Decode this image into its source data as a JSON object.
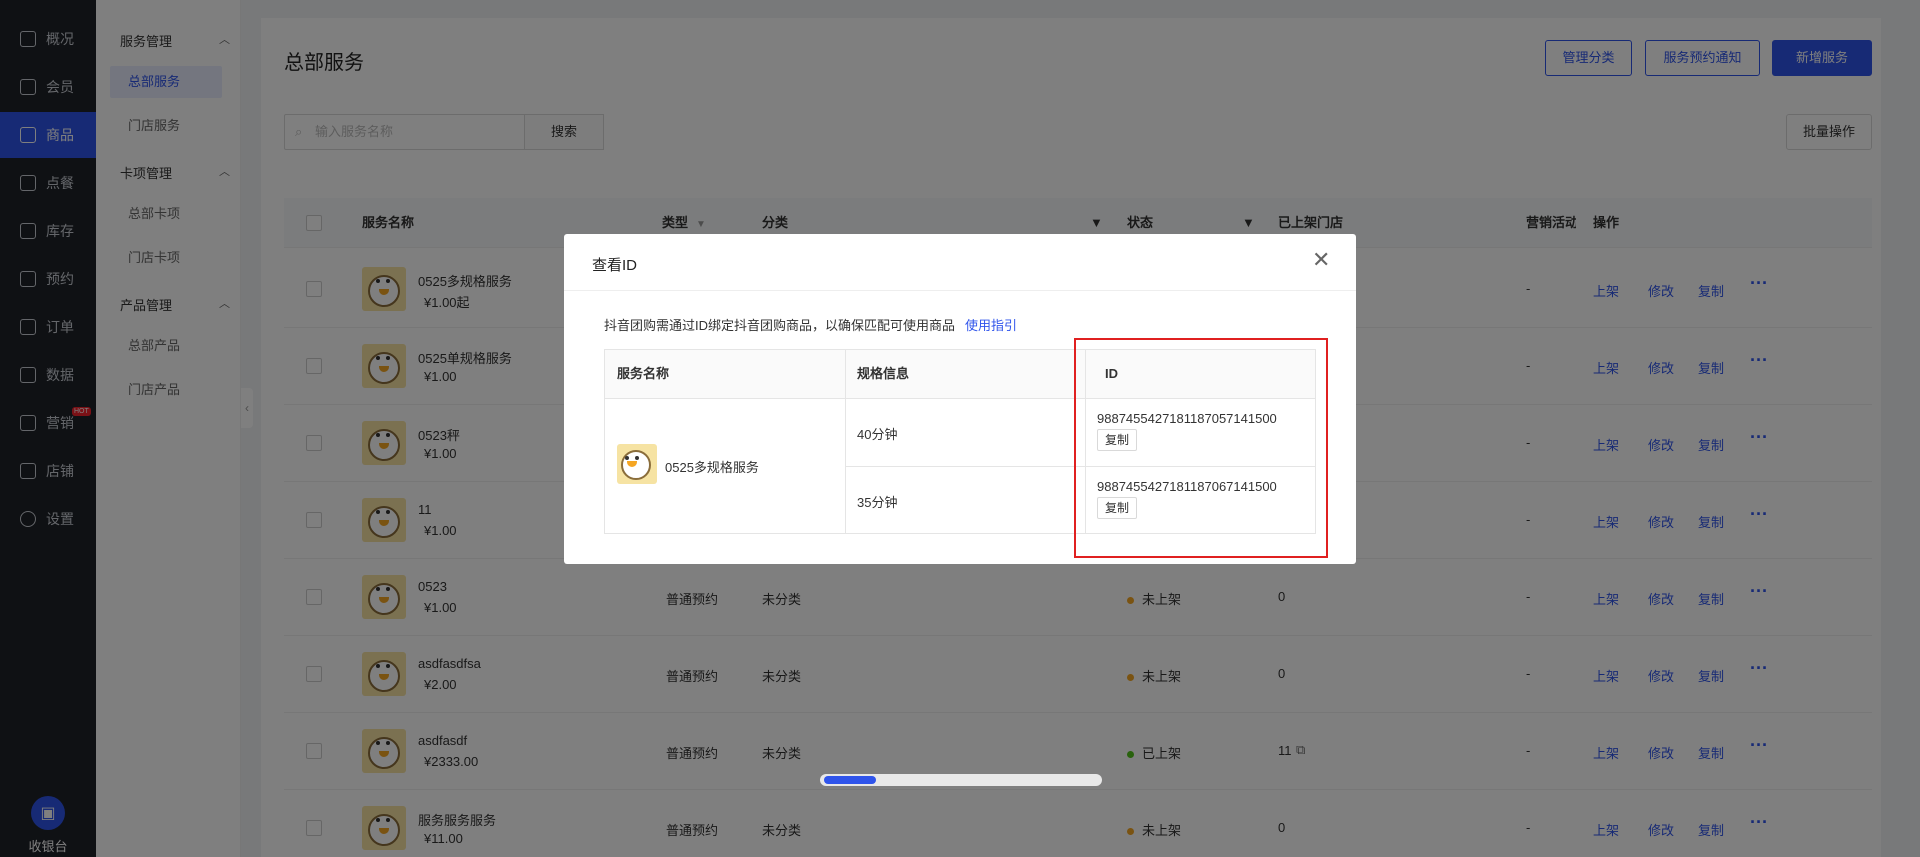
{
  "nav": {
    "items": [
      {
        "label": "概况",
        "icon": "grid-icon"
      },
      {
        "label": "会员",
        "icon": "crown-icon"
      },
      {
        "label": "商品",
        "icon": "store-icon"
      },
      {
        "label": "点餐",
        "icon": "dish-icon"
      },
      {
        "label": "库存",
        "icon": "warehouse-icon"
      },
      {
        "label": "预约",
        "icon": "calendar-check-icon"
      },
      {
        "label": "订单",
        "icon": "order-icon"
      },
      {
        "label": "数据",
        "icon": "chart-icon"
      },
      {
        "label": "营销",
        "icon": "gift-icon"
      },
      {
        "label": "店铺",
        "icon": "shop-icon"
      },
      {
        "label": "设置",
        "icon": "gear-icon"
      }
    ],
    "hot_badge": "HOT",
    "cashier_label": "收银台"
  },
  "subnav": {
    "groups": [
      {
        "title": "服务管理",
        "items": [
          "总部服务",
          "门店服务"
        ]
      },
      {
        "title": "卡项管理",
        "items": [
          "总部卡项",
          "门店卡项"
        ]
      },
      {
        "title": "产品管理",
        "items": [
          "总部产品",
          "门店产品"
        ]
      }
    ]
  },
  "header": {
    "title": "总部服务",
    "manage_category": "管理分类",
    "booking_notice": "服务预约通知",
    "add_service": "新增服务",
    "batch_ops": "批量操作"
  },
  "search": {
    "placeholder": "输入服务名称",
    "button": "搜索"
  },
  "table": {
    "columns": [
      "服务名称",
      "类型",
      "分类",
      "状态",
      "已上架门店",
      "营销活动",
      "操作"
    ],
    "ops": [
      "上架",
      "修改",
      "复制"
    ],
    "rows": [
      {
        "name": "0525多规格服务",
        "price": "¥1.00起",
        "type": "",
        "category": "",
        "status": "",
        "stores": "",
        "marketing": "-"
      },
      {
        "name": "0525单规格服务",
        "price": "¥1.00",
        "type": "",
        "category": "",
        "status": "",
        "stores": "",
        "marketing": "-"
      },
      {
        "name": "0523秤",
        "price": "¥1.00",
        "type": "",
        "category": "",
        "status": "",
        "stores": "",
        "marketing": "-"
      },
      {
        "name": "11",
        "price": "¥1.00",
        "type": "",
        "category": "",
        "status": "",
        "stores": "",
        "marketing": "-"
      },
      {
        "name": "0523",
        "price": "¥1.00",
        "type": "普通预约",
        "category": "未分类",
        "status": "未上架",
        "stores": "0",
        "marketing": "-"
      },
      {
        "name": "asdfasdfsa",
        "price": "¥2.00",
        "type": "普通预约",
        "category": "未分类",
        "status": "未上架",
        "stores": "0",
        "marketing": "-"
      },
      {
        "name": "asdfasdf",
        "price": "¥2333.00",
        "type": "普通预约",
        "category": "未分类",
        "status": "已上架",
        "stores": "11",
        "marketing": "-"
      },
      {
        "name": "服务服务服务",
        "price": "¥11.00",
        "type": "普通预约",
        "category": "未分类",
        "status": "未上架",
        "stores": "0",
        "marketing": "-"
      }
    ]
  },
  "modal": {
    "title": "查看ID",
    "tip": "抖音团购需通过ID绑定抖音团购商品，以确保匹配可使用商品",
    "guide_link": "使用指引",
    "columns": [
      "服务名称",
      "规格信息",
      "ID"
    ],
    "service_name": "0525多规格服务",
    "specs": [
      {
        "spec": "40分钟",
        "id": "988745542718118705714150​0",
        "copy": "复制"
      },
      {
        "spec": "35分钟",
        "id": "988745542718118706714150​0",
        "copy": "复制"
      }
    ]
  },
  "colors": {
    "accent": "#2f54eb",
    "nav_bg": "#1f2329",
    "highlight": "#e02020",
    "status_off": "#f5a623",
    "status_on": "#52c41a"
  }
}
